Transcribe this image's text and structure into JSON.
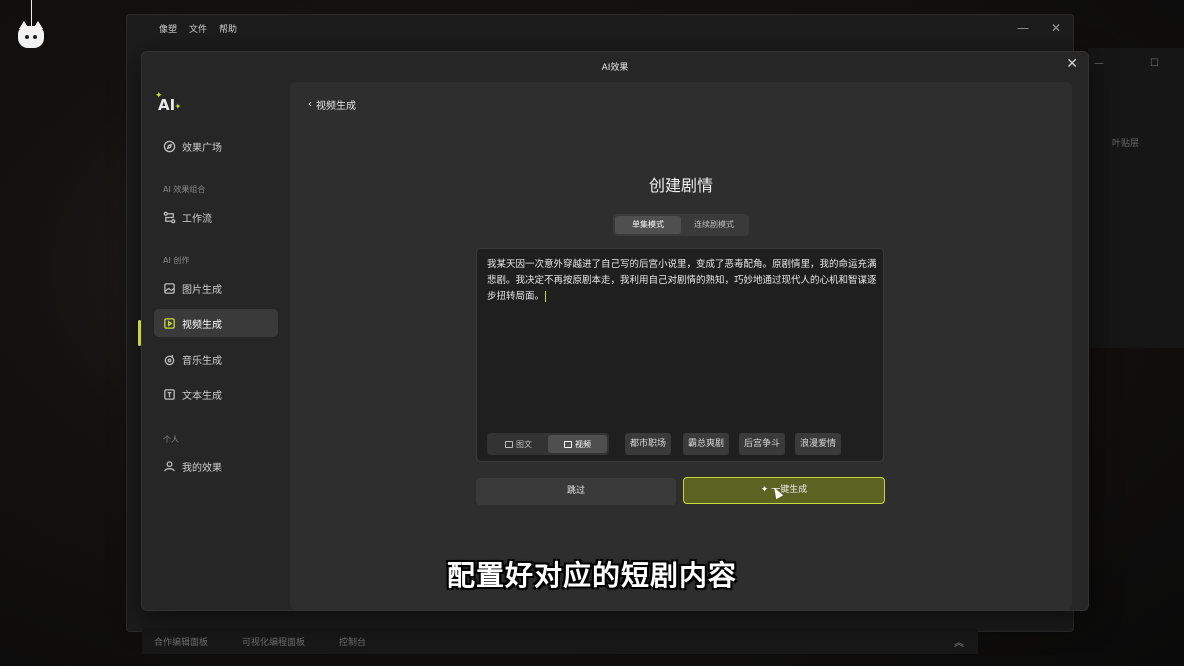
{
  "bg_app": {
    "menu": [
      "像塑",
      "文件",
      "帮助"
    ],
    "right_tab": "叶贴层",
    "bottom": [
      "合作编辑面板",
      "可视化编程面板",
      "控制台"
    ]
  },
  "modal": {
    "title": "AI效果",
    "close_icon": "close-icon"
  },
  "sidebar": {
    "brand": "AI",
    "plaza": "效果广场",
    "section_combo": "AI 效果组合",
    "workflow": "工作流",
    "section_create": "AI 创作",
    "image_gen": "图片生成",
    "video_gen": "视频生成",
    "music_gen": "音乐生成",
    "text_gen": "文本生成",
    "section_personal": "个人",
    "my_effects": "我的效果"
  },
  "content": {
    "back_label": "视频生成",
    "title": "创建剧情",
    "mode_tabs": {
      "single": "单集模式",
      "series": "连续剧模式"
    },
    "story_text": "我某天因一次意外穿越进了自己写的后宫小说里，变成了恶毒配角。原剧情里，我的命运充满悲剧。我决定不再按原剧本走，我利用自己对剧情的熟知，巧妙地通过现代人的心机和智谋逐步扭转局面。",
    "type_options": {
      "image_text": "图文",
      "video": "视频"
    },
    "genre_tags": [
      "都市职场",
      "霸总爽剧",
      "后宫争斗",
      "浪漫爱情"
    ],
    "skip_label": "跳过",
    "generate_label": "一键生成"
  },
  "subtitle": "配置好对应的短剧内容",
  "colors": {
    "accent": "#c6d93b",
    "generate_bg": "#5c6222"
  }
}
